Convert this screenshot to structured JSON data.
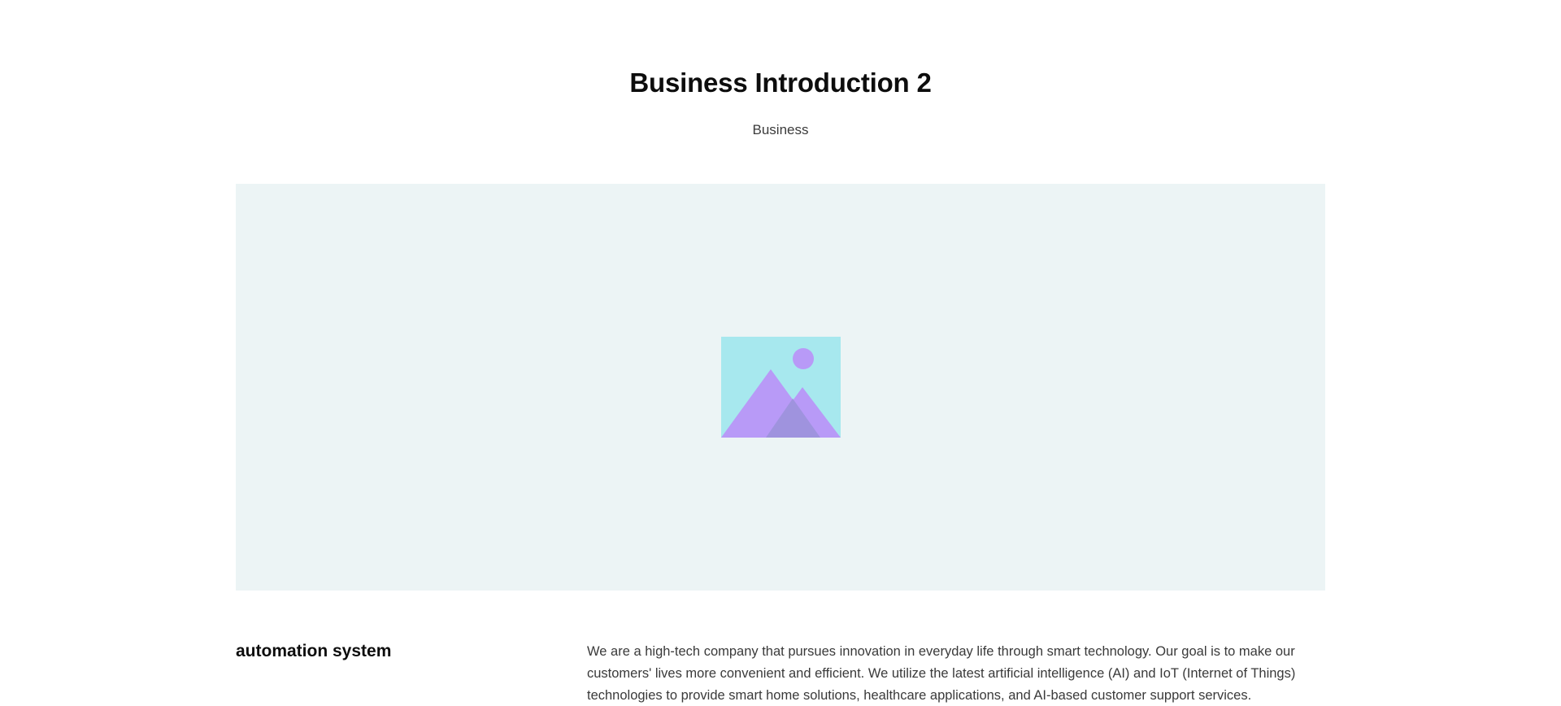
{
  "header": {
    "title": "Business Introduction 2",
    "subtitle": "Business"
  },
  "hero": {
    "icon": "image-placeholder-icon",
    "background_color": "#ecf4f5",
    "icon_colors": {
      "sky": "#a7e8ee",
      "mountain": "#b89af7",
      "mountain_overlap": "#9f93de",
      "sun": "#b89af7"
    }
  },
  "section": {
    "heading": "automation system",
    "body": "We are a high-tech company that pursues innovation in everyday life through smart technology. Our goal is to make our customers' lives more convenient and efficient. We utilize the latest artificial intelligence (AI) and IoT (Internet of Things) technologies to provide smart home solutions, healthcare applications, and AI-based customer support services."
  }
}
